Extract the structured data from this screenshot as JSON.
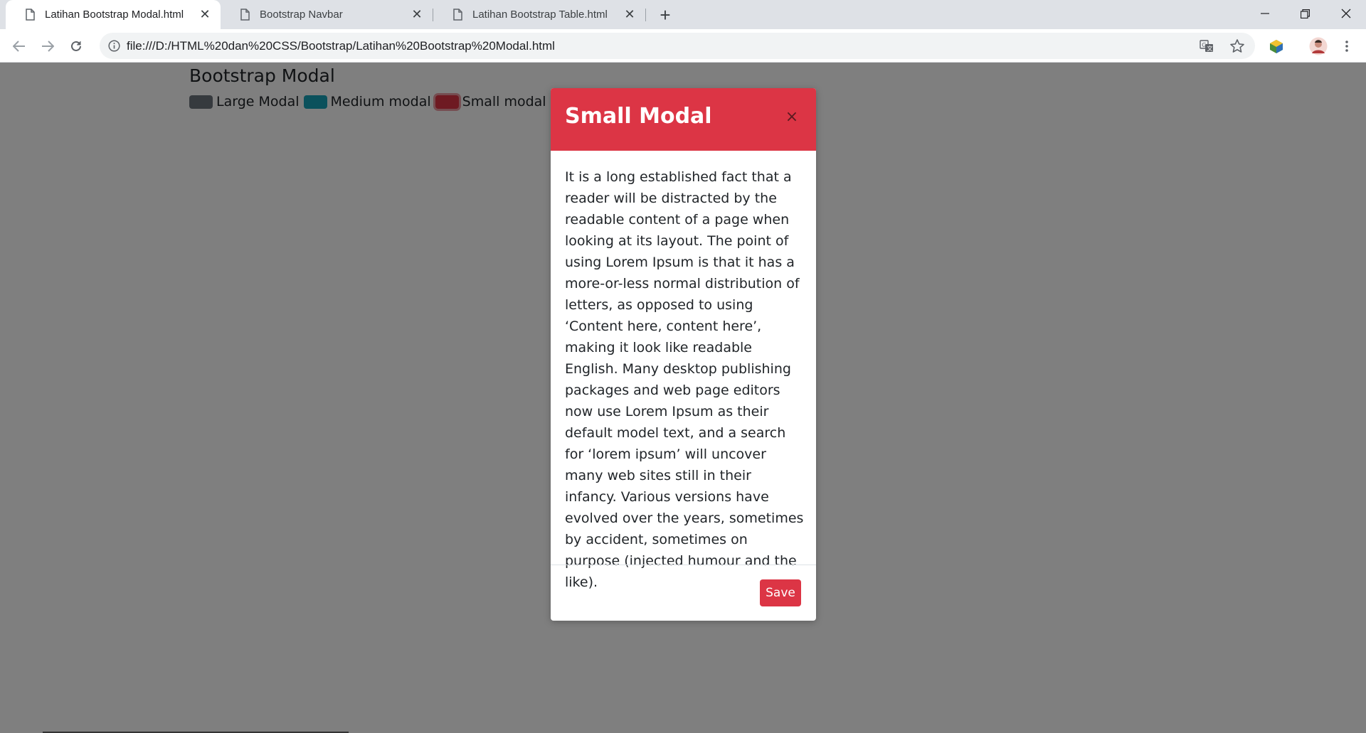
{
  "browser": {
    "tabs": [
      {
        "label": "Latihan Bootstrap Modal.html",
        "active": true
      },
      {
        "label": "Bootstrap Navbar",
        "active": false
      },
      {
        "label": "Latihan Bootstrap Table.html",
        "active": false
      }
    ],
    "new_tab_label": "+",
    "window_controls": {
      "minimize": "—",
      "restore": "❐",
      "close": "✕"
    },
    "url": "file:///D:/HTML%20dan%20CSS/Bootstrap/Latihan%20Bootstrap%20Modal.html",
    "icons": [
      "back-arrow-icon",
      "forward-arrow-icon",
      "reload-icon",
      "info-icon",
      "translate-icon",
      "star-icon",
      "extension-icon",
      "profile-avatar",
      "more-menu-icon"
    ]
  },
  "page": {
    "title": "Bootstrap Modal",
    "buttons": [
      {
        "label": "Large Modal",
        "color": "#6c757d"
      },
      {
        "label": "Medium modal",
        "color": "#17a2b8"
      },
      {
        "label": "Small modal",
        "color": "#dc3545"
      }
    ]
  },
  "modal": {
    "title": "Small Modal",
    "close_label": "×",
    "body": "It is a long established fact that a reader will be distracted by the readable content of a page when looking at its layout. The point of using Lorem Ipsum is that it has a more-or-less normal distribution of letters, as opposed to using ‘Content here, content here’, making it look like readable English. Many desktop publishing packages and web page editors now use Lorem Ipsum as their default model text, and a search for ‘lorem ipsum’ will uncover many web sites still in their infancy. Various versions have evolved over the years, sometimes by accident, sometimes on purpose (injected humour and the like).",
    "save_label": "Save",
    "header_color": "#dc3545"
  }
}
